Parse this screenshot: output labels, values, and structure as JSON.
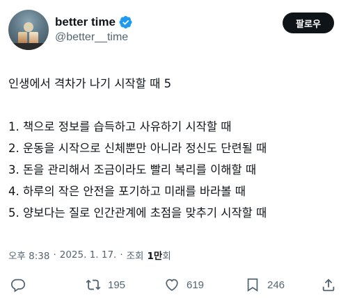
{
  "author": {
    "display_name": "better time",
    "handle": "@better__time",
    "verified": true
  },
  "follow_button": {
    "label": "팔로우"
  },
  "tweet": {
    "lines": [
      "인생에서 격차가 나기 시작할 때 5",
      "",
      "1. 책으로 정보를 습득하고 사유하기 시작할 때",
      "2. 운동을 시작으로 신체뿐만 아니라 정신도 단련될 때",
      "3. 돈을 관리해서 조금이라도 빨리 복리를 이해할 때",
      "4. 하루의 작은 안전을 포기하고 미래를 바라볼 때",
      "5. 양보다는 질로 인간관계에 초점을 맞추기 시작할 때"
    ]
  },
  "meta": {
    "time": "오후 8:38",
    "separator": "·",
    "date": "2025. 1. 17.",
    "views_label": "조회",
    "views_number": "1만",
    "views_unit": "회"
  },
  "actions": {
    "reply": {
      "icon": "reply-icon"
    },
    "retweet": {
      "icon": "retweet-icon",
      "count": "195"
    },
    "like": {
      "icon": "heart-icon",
      "count": "619"
    },
    "bookmark": {
      "icon": "bookmark-icon",
      "count": "246"
    },
    "share": {
      "icon": "share-icon"
    }
  },
  "colors": {
    "text": "#0f1419",
    "secondary": "#536471",
    "verified": "#1d9bf0",
    "follow_bg": "#0f1419"
  }
}
